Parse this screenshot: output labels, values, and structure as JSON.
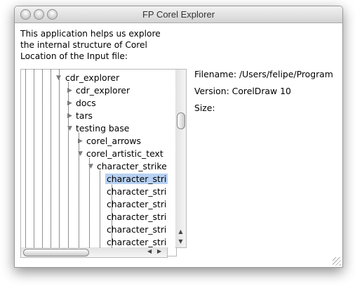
{
  "window": {
    "title": "FP Corel Explorer"
  },
  "intro": {
    "lines": [
      "This application helps us explore",
      "the internal structure of Corel",
      "Location of the Input file:"
    ]
  },
  "tree": {
    "nodes": [
      {
        "label": "cdr_explorer",
        "expanded": true
      },
      {
        "label": "cdr_explorer",
        "expanded": false
      },
      {
        "label": "docs",
        "expanded": false
      },
      {
        "label": "tars",
        "expanded": false
      },
      {
        "label": "testing base",
        "expanded": true
      },
      {
        "label": "corel_arrows",
        "expanded": false
      },
      {
        "label": "corel_artistic_text",
        "expanded": true
      },
      {
        "label": "character_strike",
        "expanded": true
      },
      {
        "label": "character_stri",
        "selected": true
      },
      {
        "label": "character_stri"
      },
      {
        "label": "character_stri"
      },
      {
        "label": "character_stri"
      },
      {
        "label": "character_stri"
      },
      {
        "label": "character_stri"
      }
    ]
  },
  "info": {
    "filename": "Filename: /Users/felipe/Program",
    "version": "Version: CorelDraw 10",
    "size": "Size:"
  },
  "colors": {
    "selection": "#b7d1f3",
    "titlebar": "#e0e0e0"
  }
}
